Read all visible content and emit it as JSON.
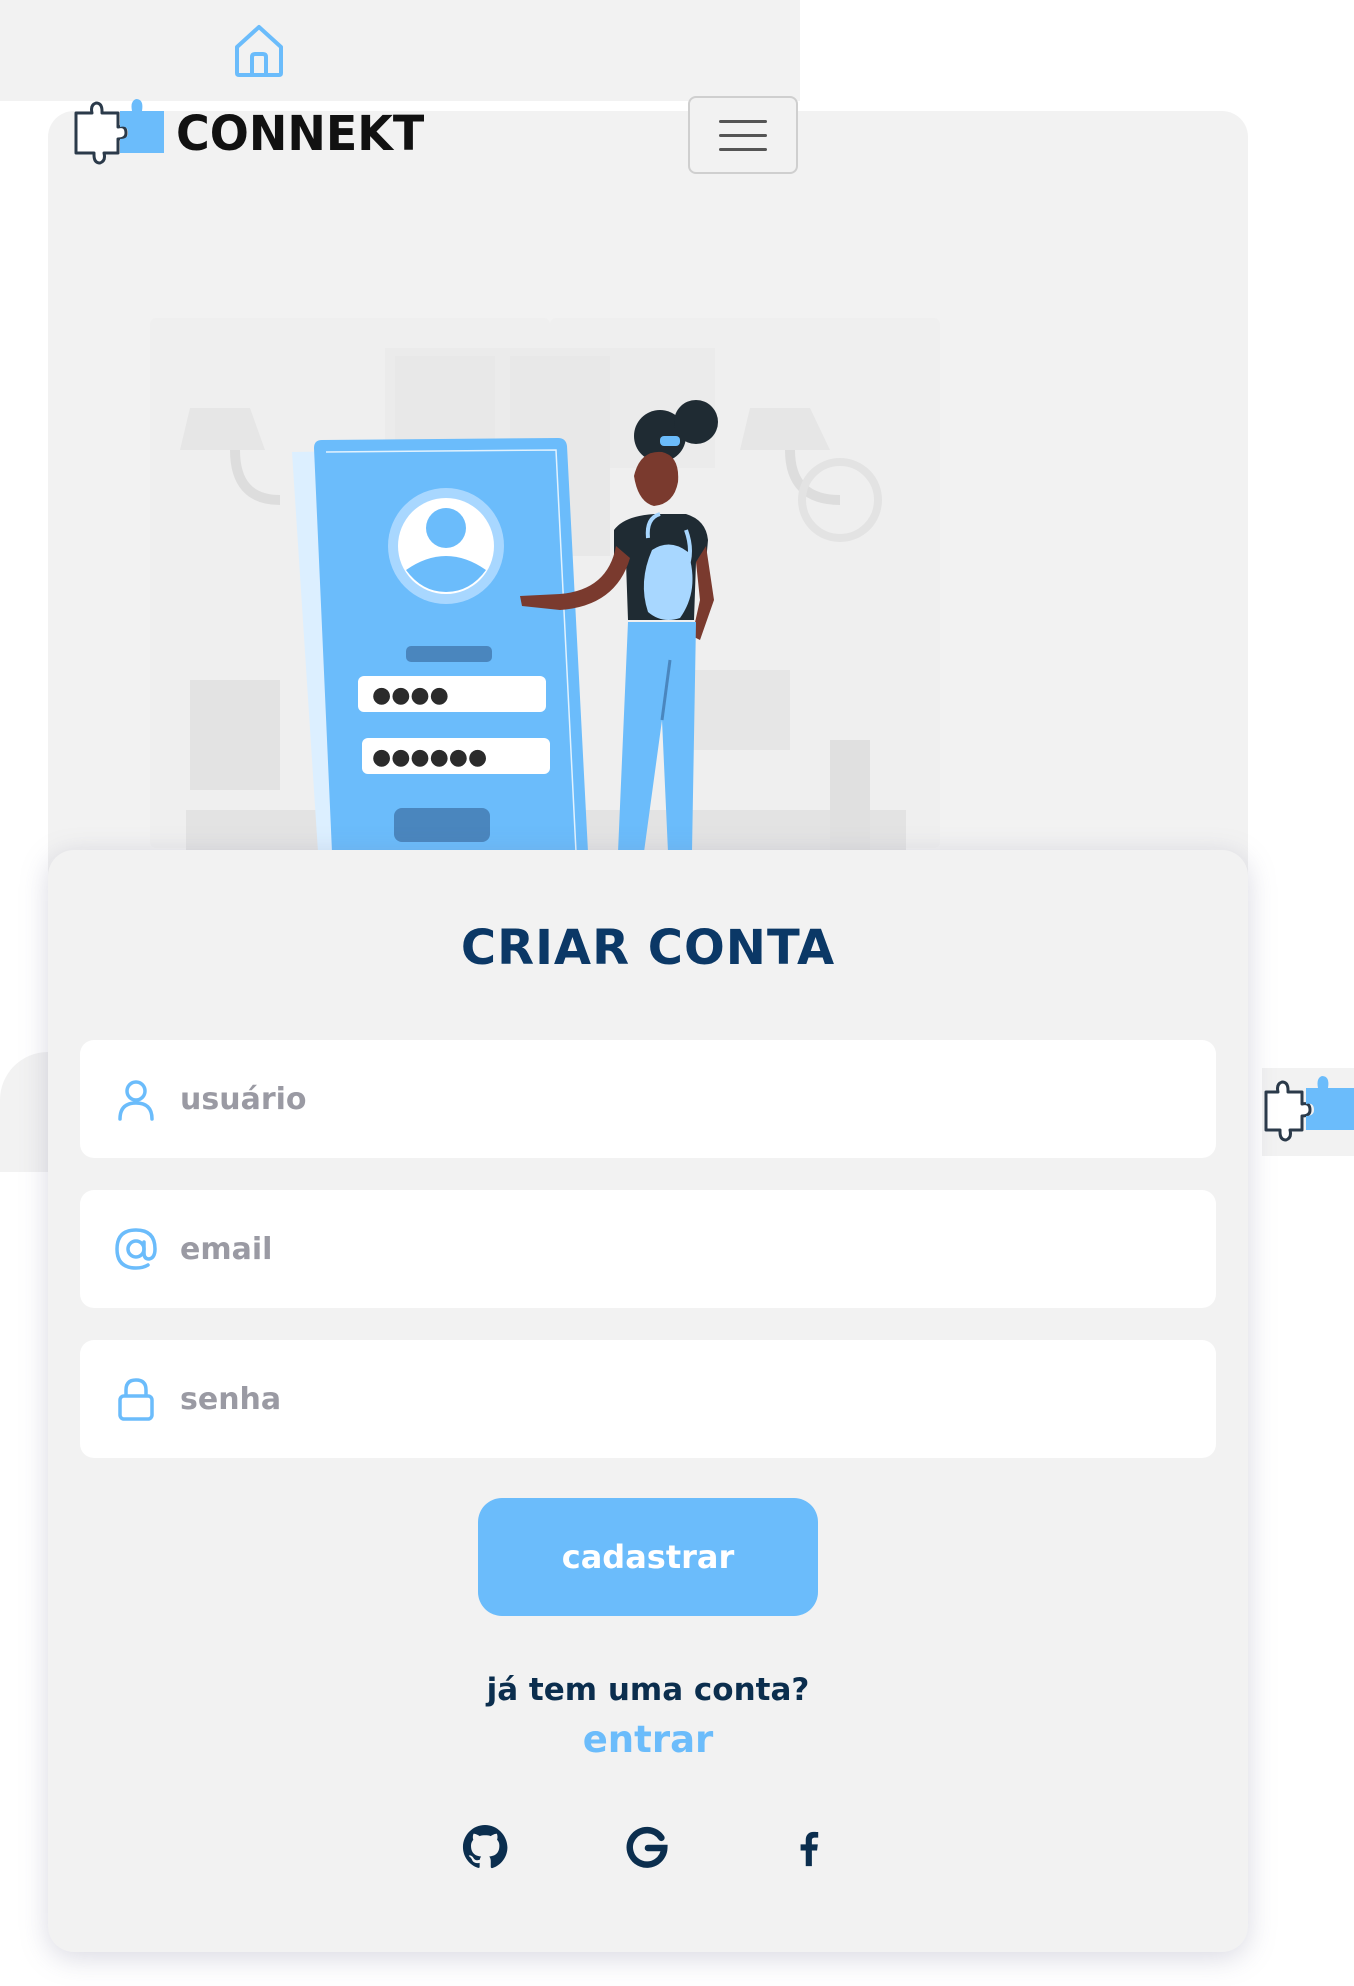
{
  "nav": {
    "home_icon": "home-icon",
    "brand": "CONNEKT",
    "menu_icon": "hamburger-icon"
  },
  "form": {
    "title": "CRIAR CONTA",
    "fields": [
      {
        "icon": "user-icon",
        "placeholder": "usuário",
        "value": ""
      },
      {
        "icon": "at-icon",
        "placeholder": "email",
        "value": ""
      },
      {
        "icon": "lock-icon",
        "placeholder": "senha",
        "value": ""
      }
    ],
    "submit_label": "cadastrar",
    "have_account": "já tem uma conta?",
    "login_link": "entrar",
    "social": [
      "github-icon",
      "google-icon",
      "facebook-icon"
    ]
  },
  "illustration": {
    "password_dots_1": "●●●●",
    "password_dots_2": "●●●●●●"
  },
  "colors": {
    "accent": "#6bbcfb",
    "title": "#0b3866",
    "panel": "#f2f2f2"
  }
}
